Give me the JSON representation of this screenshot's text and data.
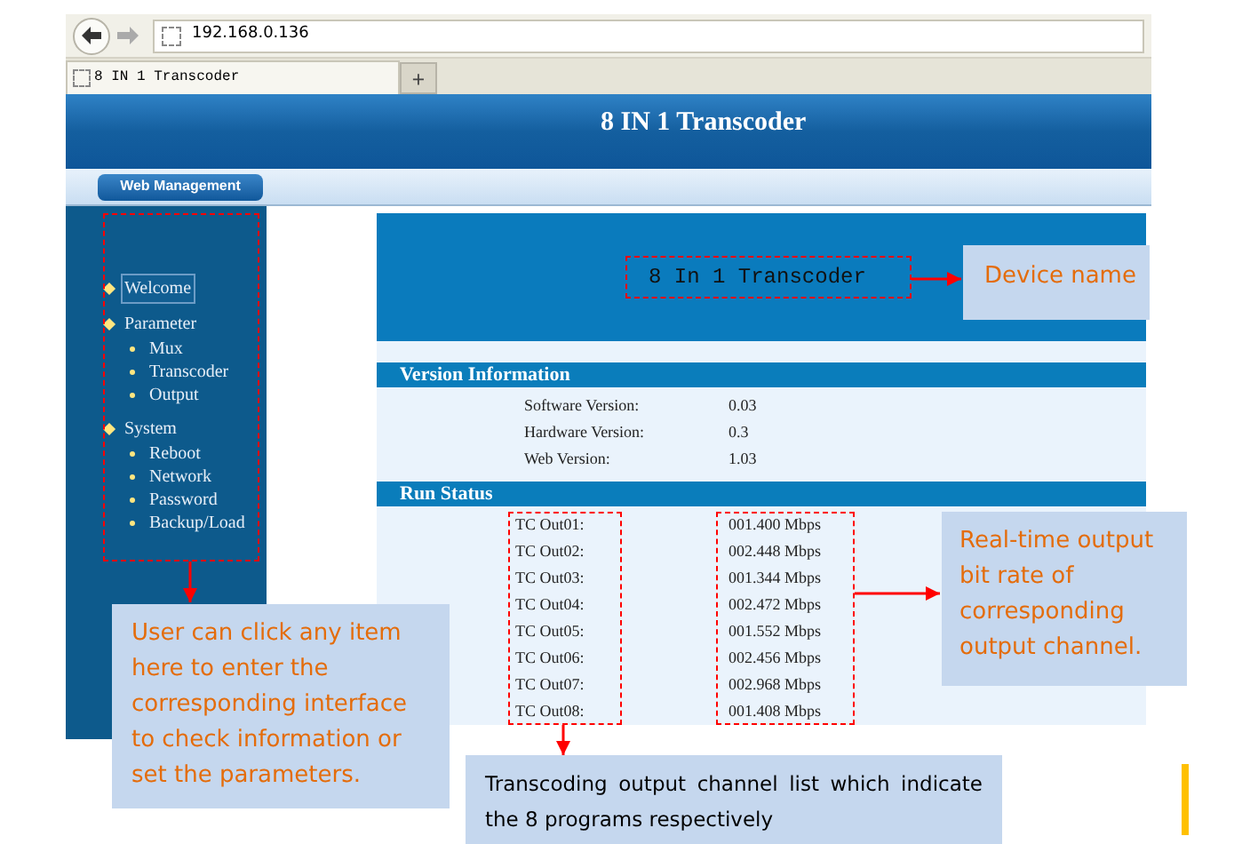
{
  "browser": {
    "address": "192.168.0.136",
    "tab_title": "8 IN 1 Transcoder",
    "new_tab_button": "+"
  },
  "header": {
    "title": "8 IN 1 Transcoder",
    "menu_button": "Web Management"
  },
  "sidebar": {
    "items": [
      {
        "label": "Welcome",
        "selected": true
      },
      {
        "label": "Parameter",
        "selected": false,
        "children": [
          {
            "label": "Mux",
            "selected": false
          },
          {
            "label": "Transcoder",
            "selected": false
          },
          {
            "label": "Output",
            "selected": false
          }
        ]
      },
      {
        "label": "System",
        "selected": false,
        "children": [
          {
            "label": "Reboot",
            "selected": false
          },
          {
            "label": "Network",
            "selected": false
          },
          {
            "label": "Password",
            "selected": false
          },
          {
            "label": "Backup/Load",
            "selected": false
          }
        ]
      }
    ]
  },
  "device_name": "8 In 1 Transcoder",
  "version_info": {
    "title": "Version Information",
    "rows": [
      {
        "label": "Software Version:",
        "value": "0.03"
      },
      {
        "label": "Hardware Version:",
        "value": "0.3"
      },
      {
        "label": "Web Version:",
        "value": "1.03"
      }
    ]
  },
  "run_status": {
    "title": "Run Status",
    "rows": [
      {
        "label": "TC Out01:",
        "value": "001.400 Mbps"
      },
      {
        "label": "TC Out02:",
        "value": "002.448 Mbps"
      },
      {
        "label": "TC Out03:",
        "value": "001.344 Mbps"
      },
      {
        "label": "TC Out04:",
        "value": "002.472 Mbps"
      },
      {
        "label": "TC Out05:",
        "value": "001.552 Mbps"
      },
      {
        "label": "TC Out06:",
        "value": "002.456 Mbps"
      },
      {
        "label": "TC Out07:",
        "value": "002.968 Mbps"
      },
      {
        "label": "TC Out08:",
        "value": "001.408 Mbps"
      }
    ]
  },
  "annotations": [
    {
      "kind": "callout",
      "text": "Device name"
    },
    {
      "kind": "callout",
      "text": "User can click any item here to enter the corresponding interface to check information or set the parameters."
    },
    {
      "kind": "callout",
      "text": "Real-time output bit rate of corresponding output channel."
    },
    {
      "kind": "note",
      "text": "Transcoding output channel list which indicate the 8 programs respectively"
    }
  ]
}
